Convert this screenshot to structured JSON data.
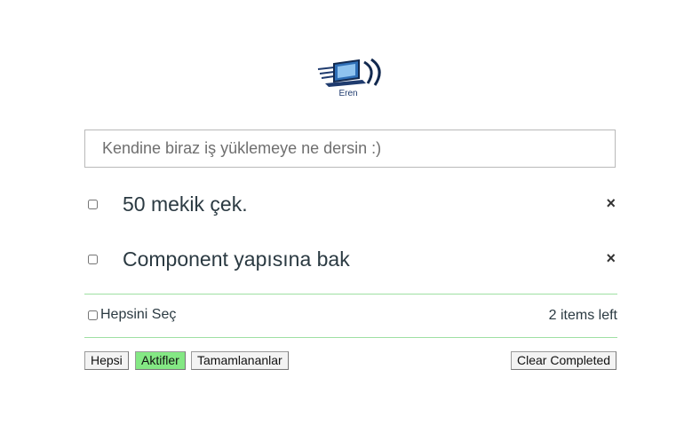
{
  "logo": {
    "text": "Eren",
    "icon": "laptop-speed-icon"
  },
  "new_todo": {
    "placeholder": "Kendine biraz iş yüklemeye ne dersin :)",
    "value": ""
  },
  "todos": [
    {
      "label": "50 mekik çek.",
      "completed": false,
      "delete_glyph": "×"
    },
    {
      "label": "Component yapısına bak",
      "completed": false,
      "delete_glyph": "×"
    }
  ],
  "footer": {
    "select_all_label": "Hepsini Seç",
    "items_left": "2 items left"
  },
  "filters": [
    {
      "label": "Hepsi",
      "active": false
    },
    {
      "label": "Aktifler",
      "active": true
    },
    {
      "label": "Tamamlananlar",
      "active": false
    }
  ],
  "clear_completed_label": "Clear Completed",
  "colors": {
    "accent_green": "#84e884",
    "separator": "#9fe0a3"
  }
}
